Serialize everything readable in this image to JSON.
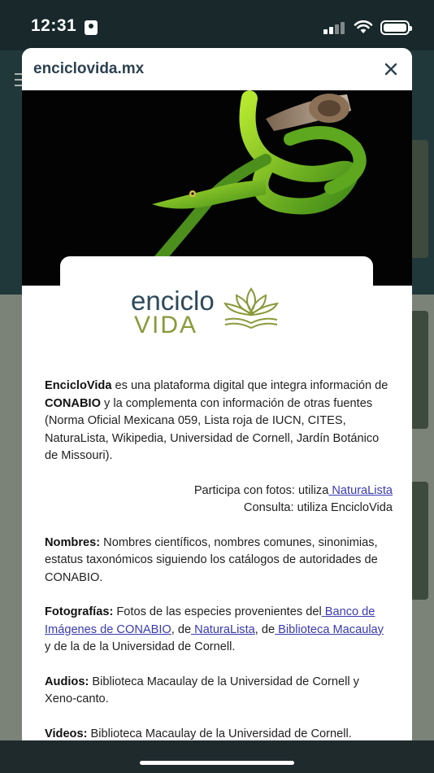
{
  "status_bar": {
    "time": "12:31"
  },
  "modal": {
    "title": "enciclovida.mx",
    "close_icon": "close-icon",
    "logo": {
      "line1": "enciclo",
      "line2": "VIDA"
    },
    "intro": {
      "brand": "EncicloVida",
      "part1": " es una plataforma digital que integra información de ",
      "org": "CONABIO",
      "part2": " y la complementa con información de otras fuentes (Norma Oficial Mexicana 059, Lista roja de IUCN, CITES, NaturaLista, Wikipedia, Universidad de Cornell, Jardín Botánico de Missouri)."
    },
    "participa": {
      "text": "Participa con fotos: utiliza",
      "link": " NaturaLista"
    },
    "consulta": "Consulta: utiliza EncicloVida",
    "nombres": {
      "label": "Nombres:",
      "text": " Nombres científicos, nombres comunes, sinonimias, estatus taxonómicos siguiendo los catálogos de autoridades de CONABIO."
    },
    "fotografias": {
      "label": "Fotografías:",
      "text1": " Fotos de las especies provenientes del",
      "link1": " Banco de Imágenes de CONABIO",
      "text2": ", de",
      "link2": " NaturaLista",
      "text3": ", de",
      "link3": " Biblioteca Macaulay",
      "text4": " y de la  de la Universidad de Cornell."
    },
    "audios": {
      "label": "Audios:",
      "text": " Biblioteca Macaulay de la Universidad de Cornell y Xeno-canto."
    },
    "videos": {
      "label": "Videos:",
      "text": " Biblioteca Macaulay de la Universidad de Cornell."
    }
  },
  "colors": {
    "title": "#2c4250",
    "link": "#3a3ab0",
    "logo_dark": "#2c4a5a",
    "logo_olive": "#8a9a3a"
  }
}
